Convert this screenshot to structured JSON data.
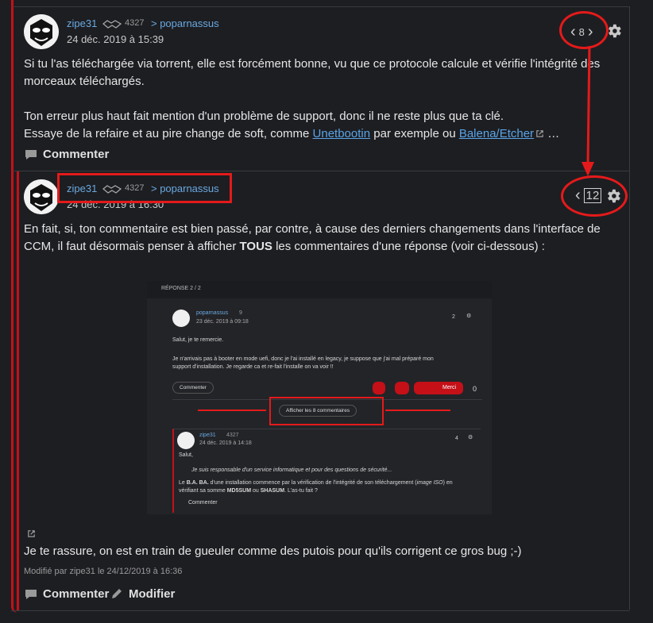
{
  "comment1": {
    "username": "zipe31",
    "reputation": "4327",
    "reply_to": "> poparnassus",
    "date": "24 déc. 2019 à 15:39",
    "nav_count": "8",
    "para1_line1": "Si tu l'as téléchargée via torrent, elle est forcément bonne, vu que ce protocole calcule et vérifie l'intégrité des",
    "para1_line2": "morceaux téléchargés.",
    "para2_line1": "Ton erreur plus haut fait mention d'un problème de support, donc il ne reste plus que ta clé.",
    "para2_line2_prefix": "Essaye de la refaire et au pire change de soft, comme ",
    "link1": "Unetbootin",
    "mid": " par exemple ou ",
    "link2": "Balena/Etcher",
    "ellipsis": " …",
    "comment_label": "Commenter"
  },
  "comment2": {
    "username": "zipe31",
    "reputation": "4327",
    "reply_to": "> poparnassus",
    "date": "24 déc. 2019 à 16:30",
    "nav_count": "12",
    "line1": "En fait, si, ton commentaire est bien passé, par contre, à cause des derniers changements dans l'interface de",
    "line2_prefix": "CCM, il faut désormais penser à afficher ",
    "line2_bold": "TOUS",
    "line2_suffix": " les commentaires d'une réponse (voir ci-dessous) :",
    "closing": "Je te rassure, on est en train de gueuler comme des putois pour qu'ils corrigent ce gros bug ;-)",
    "modified": "Modifié par zipe31 le 24/12/2019 à 16:36",
    "comment_label": "Commenter",
    "edit_label": "Modifier"
  },
  "embedded": {
    "header": "RÉPONSE 2 / 2",
    "username": "poparnassus",
    "reputation": "9",
    "date": "23 déc. 2019 à 09:18",
    "nav": "2",
    "greet": "Salut, je te remercie.",
    "body1": "Je n'arrivais pas à booter en mode uefi, donc je l'ai installé en legacy, je suppose que j'ai mal préparé mon",
    "body2": "support d'installation. Je regarde ca et re-fait l'installe on va voir !!",
    "comment_btn": "Commenter",
    "merci": "Merci",
    "votes": "0",
    "show_all": "Afficher les 8 commentaires",
    "n_username": "zipe31",
    "n_reputation": "4327",
    "n_date": "24 déc. 2019 à 14:18",
    "n_nav": "4",
    "n_salut": "Salut,",
    "n_quote": "Je suis responsable d'un service informatique et pour des questions de sécurité...",
    "n_body1_a": "Le ",
    "n_body1_b": "B.A. BA.",
    "n_body1_c": " d'une installation commence par la vérification de l'intégrité de son téléchargement (",
    "n_body1_d": "image ISO",
    "n_body1_e": ") en",
    "n_body2_a": "vérifiant sa somme ",
    "n_body2_b": "MD5SUM",
    "n_body2_c": " ou ",
    "n_body2_d": "SHASUM",
    "n_body2_e": ". L'as-tu fait ?",
    "n_comment": "Commenter"
  },
  "colors": {
    "accent_red": "#c51018",
    "annotation_red": "#e41a1a",
    "link_blue": "#5aa4e6"
  }
}
